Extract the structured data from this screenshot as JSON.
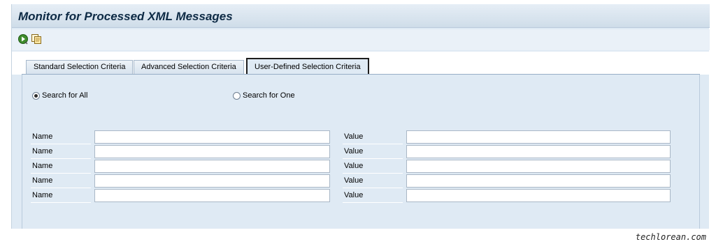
{
  "window": {
    "title": "Monitor for Processed XML Messages"
  },
  "toolbar": {
    "buttons": [
      {
        "icon": "execute-icon"
      },
      {
        "icon": "copy-icon"
      }
    ]
  },
  "tabs": [
    {
      "label": "Standard Selection Criteria",
      "active": false
    },
    {
      "label": "Advanced Selection Criteria",
      "active": false
    },
    {
      "label": "User-Defined Selection Criteria",
      "active": true
    }
  ],
  "search_mode": {
    "options": [
      {
        "label": "Search for All",
        "checked": true
      },
      {
        "label": "Search for One",
        "checked": false
      }
    ]
  },
  "criteria": {
    "rows": [
      {
        "name_label": "Name",
        "name_value": "",
        "value_label": "Value",
        "value_value": ""
      },
      {
        "name_label": "Name",
        "name_value": "",
        "value_label": "Value",
        "value_value": ""
      },
      {
        "name_label": "Name",
        "name_value": "",
        "value_label": "Value",
        "value_value": ""
      },
      {
        "name_label": "Name",
        "name_value": "",
        "value_label": "Value",
        "value_value": ""
      },
      {
        "name_label": "Name",
        "name_value": "",
        "value_label": "Value",
        "value_value": ""
      }
    ]
  },
  "watermark": "techlorean.com",
  "colors": {
    "panel": "#dfeaf4",
    "title": "#0d2a45",
    "active_tab_border": "#1d1d1d"
  }
}
